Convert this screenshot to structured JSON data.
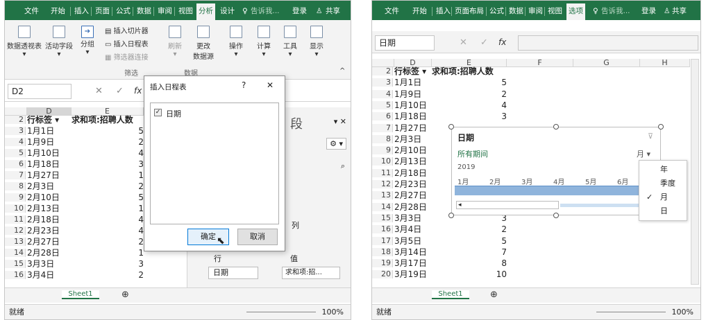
{
  "left": {
    "tabs": [
      "文件",
      "开始",
      "插入",
      "页面",
      "公式",
      "数据",
      "审阅",
      "视图",
      "分析",
      "设计"
    ],
    "tell": "告诉我...",
    "login": "登录",
    "share": "共享",
    "ribbon": {
      "pivot": "数据透视表",
      "active_field": "活动字段",
      "group": "分组",
      "insert_slicer": "插入切片器",
      "insert_timeline": "插入日程表",
      "filter_conn": "筛选器连接",
      "filter_group": "筛选",
      "refresh": "刷新",
      "change_source_1": "更改",
      "change_source_2": "数据源",
      "data_group": "数据",
      "actions": "操作",
      "calc": "计算",
      "tools": "工具",
      "show": "显示"
    },
    "namebox": "D2",
    "col_d": "D",
    "col_e": "E",
    "header_d": "行标签",
    "header_e": "求和项:招聘人数",
    "rows": [
      {
        "n": "2"
      },
      {
        "n": "3",
        "d": "1月1日",
        "e": "5"
      },
      {
        "n": "4",
        "d": "1月9日",
        "e": "2"
      },
      {
        "n": "5",
        "d": "1月10日",
        "e": "4"
      },
      {
        "n": "6",
        "d": "1月18日",
        "e": "3"
      },
      {
        "n": "7",
        "d": "1月27日",
        "e": "1"
      },
      {
        "n": "8",
        "d": "2月3日",
        "e": "2"
      },
      {
        "n": "9",
        "d": "2月10日",
        "e": "5"
      },
      {
        "n": "10",
        "d": "2月13日",
        "e": "1"
      },
      {
        "n": "11",
        "d": "2月18日",
        "e": "4"
      },
      {
        "n": "12",
        "d": "2月23日",
        "e": "4"
      },
      {
        "n": "13",
        "d": "2月27日",
        "e": "2"
      },
      {
        "n": "14",
        "d": "2月28日",
        "e": "1"
      },
      {
        "n": "15",
        "d": "3月3日",
        "e": "3"
      },
      {
        "n": "16",
        "d": "3月4日",
        "e": "2"
      }
    ],
    "sheet": "Sheet1",
    "status": "就绪",
    "zoom": "100%",
    "dialog": {
      "title": "插入日程表",
      "help": "?",
      "close": "✕",
      "item": "日期",
      "ok": "确定",
      "cancel": "取消"
    },
    "pane": {
      "title_frag": "段",
      "col_label": "列",
      "row_label": "行",
      "val_label": "值",
      "row_field": "日期",
      "val_field": "求和项:招..."
    }
  },
  "right": {
    "tabs": [
      "文件",
      "开始",
      "插入",
      "页面布局",
      "公式",
      "数据",
      "审阅",
      "视图",
      "选项"
    ],
    "tell": "告诉我...",
    "login": "登录",
    "share": "共享",
    "namebox": "日期",
    "cols": [
      "D",
      "E",
      "F",
      "G",
      "H"
    ],
    "header_d": "行标签",
    "header_e": "求和项:招聘人数",
    "rows": [
      {
        "n": "2"
      },
      {
        "n": "3",
        "d": "1月1日",
        "e": "5"
      },
      {
        "n": "4",
        "d": "1月9日",
        "e": "2"
      },
      {
        "n": "5",
        "d": "1月10日",
        "e": "4"
      },
      {
        "n": "6",
        "d": "1月18日",
        "e": "3"
      },
      {
        "n": "7",
        "d": "1月27日",
        "e": ""
      },
      {
        "n": "8",
        "d": "2月3日",
        "e": ""
      },
      {
        "n": "9",
        "d": "2月10日",
        "e": ""
      },
      {
        "n": "10",
        "d": "2月13日",
        "e": ""
      },
      {
        "n": "11",
        "d": "2月18日",
        "e": ""
      },
      {
        "n": "12",
        "d": "2月23日",
        "e": ""
      },
      {
        "n": "13",
        "d": "2月27日",
        "e": ""
      },
      {
        "n": "14",
        "d": "2月28日",
        "e": ""
      },
      {
        "n": "15",
        "d": "3月3日",
        "e": "3"
      },
      {
        "n": "16",
        "d": "3月4日",
        "e": "2"
      },
      {
        "n": "17",
        "d": "3月5日",
        "e": "5"
      },
      {
        "n": "18",
        "d": "3月14日",
        "e": "7"
      },
      {
        "n": "19",
        "d": "3月17日",
        "e": "8"
      },
      {
        "n": "20",
        "d": "3月19日",
        "e": "10"
      }
    ],
    "sheet": "Sheet1",
    "status": "就绪",
    "zoom": "100%",
    "timeline": {
      "title": "日期",
      "period": "所有期间",
      "level": "月",
      "year": "2019",
      "months": [
        "1月",
        "2月",
        "3月",
        "4月",
        "5月",
        "6月"
      ]
    },
    "menu": {
      "items": [
        "年",
        "季度",
        "月",
        "日"
      ],
      "checked": "月"
    }
  }
}
